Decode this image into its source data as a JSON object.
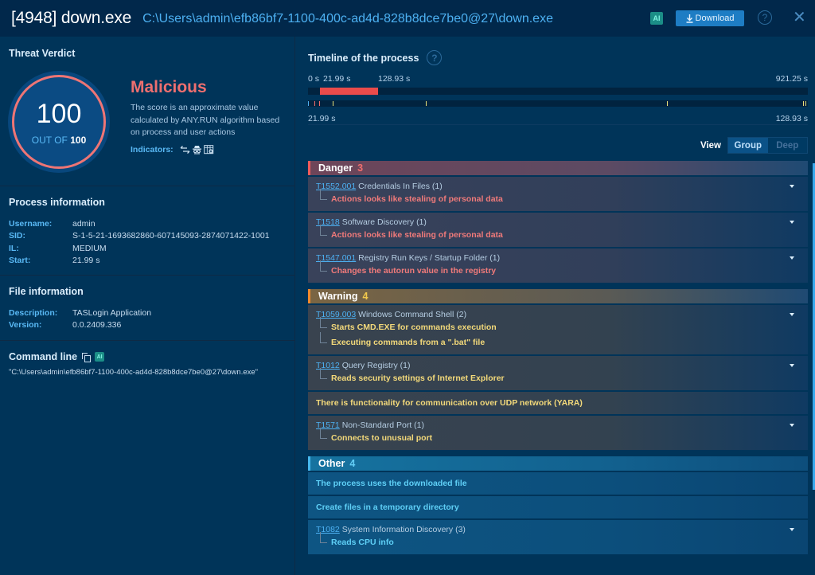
{
  "header": {
    "title": "[4948] down.exe",
    "path": "C:\\Users\\admin\\efb86bf7-1100-400c-ad4d-828b8dce7be0@27\\down.exe",
    "ai_label": "AI",
    "download_label": "Download",
    "download_icon": "download-arrow-icon",
    "help_icon": "?",
    "close_icon": "✕"
  },
  "verdict": {
    "section_title": "Threat Verdict",
    "score": "100",
    "out_of_label": "OUT OF",
    "out_of_value": "100",
    "label": "Malicious",
    "description": "The score is an approximate value calculated by ANY.RUN algorithm based on process and user actions",
    "indicators_label": "Indicators:",
    "indicator_icons": [
      "network-arrows-icon",
      "spy-icon",
      "registry-grid-icon"
    ],
    "colors": {
      "malicious": "#ef6f6f",
      "ring": "#ee7575"
    }
  },
  "process_info": {
    "title": "Process information",
    "fields": [
      {
        "key": "Username:",
        "value": "admin"
      },
      {
        "key": "SID:",
        "value": "S-1-5-21-1693682860-607145093-2874071422-1001"
      },
      {
        "key": "IL:",
        "value": "MEDIUM"
      },
      {
        "key": "Start:",
        "value": "21.99 s"
      }
    ]
  },
  "file_info": {
    "title": "File information",
    "fields": [
      {
        "key": "Description:",
        "value": "TASLogin Application"
      },
      {
        "key": "Version:",
        "value": "0.0.2409.336"
      }
    ]
  },
  "command_line": {
    "title": "Command line",
    "ai_label": "AI",
    "value": "\"C:\\Users\\admin\\efb86bf7-1100-400c-ad4d-828b8dce7be0@27\\down.exe\""
  },
  "timeline": {
    "title": "Timeline of the process",
    "labels_top": {
      "start": "0 s",
      "proc_start": "21.99 s",
      "proc_end": "128.93 s",
      "total": "921.25 s"
    },
    "labels_bottom": {
      "start": "21.99 s",
      "end": "128.93 s"
    },
    "total_seconds": 921.25,
    "process_span_seconds": [
      21.99,
      128.93
    ],
    "event_ticks": [
      {
        "pos": 0.0,
        "color": "#4db1f2"
      },
      {
        "pos": 0.012,
        "color": "#ef6f6f"
      },
      {
        "pos": 0.022,
        "color": "#ef6f6f"
      },
      {
        "pos": 0.05,
        "color": "#e8e27a"
      },
      {
        "pos": 0.236,
        "color": "#e8e27a"
      },
      {
        "pos": 0.72,
        "color": "#e8e27a"
      },
      {
        "pos": 0.994,
        "color": "#e8e27a"
      },
      {
        "pos": 0.998,
        "color": "#e8e27a"
      }
    ]
  },
  "view": {
    "label": "View",
    "options": [
      "Group",
      "Deep"
    ],
    "selected": "Group"
  },
  "groups": [
    {
      "name": "Danger",
      "count": "3",
      "items": [
        {
          "tid": "T1552.001",
          "title": "Credentials In Files (1)",
          "subs": [
            "Actions looks like stealing of personal data"
          ]
        },
        {
          "tid": "T1518",
          "title": "Software Discovery (1)",
          "subs": [
            "Actions looks like stealing of personal data"
          ]
        },
        {
          "tid": "T1547.001",
          "title": "Registry Run Keys / Startup Folder (1)",
          "subs": [
            "Changes the autorun value in the registry"
          ]
        }
      ]
    },
    {
      "name": "Warning",
      "count": "4",
      "items": [
        {
          "tid": "T1059.003",
          "title": "Windows Command Shell (2)",
          "subs": [
            "Starts CMD.EXE for commands execution",
            "Executing commands from a \".bat\" file"
          ]
        },
        {
          "tid": "T1012",
          "title": "Query Registry (1)",
          "subs": [
            "Reads security settings of Internet Explorer"
          ]
        },
        {
          "plain": "There is functionality for communication over UDP network (YARA)"
        },
        {
          "tid": "T1571",
          "title": "Non-Standard Port (1)",
          "subs": [
            "Connects to unusual port"
          ]
        }
      ]
    },
    {
      "name": "Other",
      "count": "4",
      "items": [
        {
          "plain": "The process uses the downloaded file"
        },
        {
          "plain": "Create files in a temporary directory"
        },
        {
          "tid": "T1082",
          "title": "System Information Discovery (3)",
          "subs": [
            "Reads CPU info"
          ]
        }
      ]
    }
  ]
}
